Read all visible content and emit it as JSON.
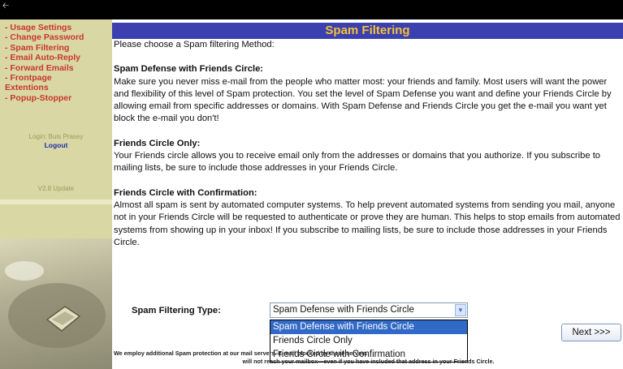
{
  "back_icon": "arrow-left-icon",
  "sidebar": {
    "items": [
      {
        "label": "- Usage Settings"
      },
      {
        "label": "- Change Password"
      },
      {
        "label": "- Spam Filtering"
      },
      {
        "label": "- Email Auto-Reply"
      },
      {
        "label": "- Forward Emails"
      },
      {
        "label": "- Frontpage"
      },
      {
        "label": "Extentions"
      },
      {
        "label": "- Popup-Stopper"
      }
    ],
    "login_text": "Login: Buis Prasey",
    "logout_label": "Logout",
    "version_text": "V2.8 Update"
  },
  "header": {
    "title": "Spam Filtering"
  },
  "main": {
    "intro": "Please choose a Spam filtering Method:",
    "sections": [
      {
        "title": "Spam Defense with Friends Circle:",
        "body": "Make sure you never miss e-mail from the people who matter most: your friends and family. Most users will want the power and flexibility of this level of Spam protection. You set the level of Spam Defense you want and define your Friends Circle by allowing email from specific addresses or domains. With Spam Defense and Friends Circle you get the e-mail you want yet block the e-mail you don't!"
      },
      {
        "title": "Friends Circle Only:",
        "body": "Your Friends circle allows you to receive email only from the addresses or domains that you authorize. If you subscribe to mailing lists, be sure to include those addresses in your Friends Circle."
      },
      {
        "title": "Friends Circle with Confirmation:",
        "body": "Almost all spam is sent by automated computer systems. To help prevent automated systems from sending you mail, anyone not in your Friends Circle will be requested to authenticate or prove they are human. This helps to stop emails from automated systems from showing up in your inbox! If you subscribe to mailing lists, be sure to include those addresses in your Friends Circle."
      }
    ],
    "filter_label": "Spam Filtering Type:",
    "select_value": "Spam Defense with Friends Circle",
    "options": [
      {
        "label": "Spam Defense with Friends Circle"
      },
      {
        "label": "Friends Circle Only"
      },
      {
        "label": "Friends Circle with Confirmation"
      }
    ],
    "next_label": "Next >>>",
    "footer_line1": "We employ additional Spam protection at our mail servers. E-mail blocked by these servers",
    "footer_line2": "will not reach your mailbox—even if you have included that address in your Friends Circle."
  },
  "colors": {
    "header_bg": "#3b3fb0",
    "header_text": "#f2c23a",
    "sidebar_bg": "#d9d7a3",
    "nav_link": "#c8372d",
    "selection": "#3169c6"
  }
}
